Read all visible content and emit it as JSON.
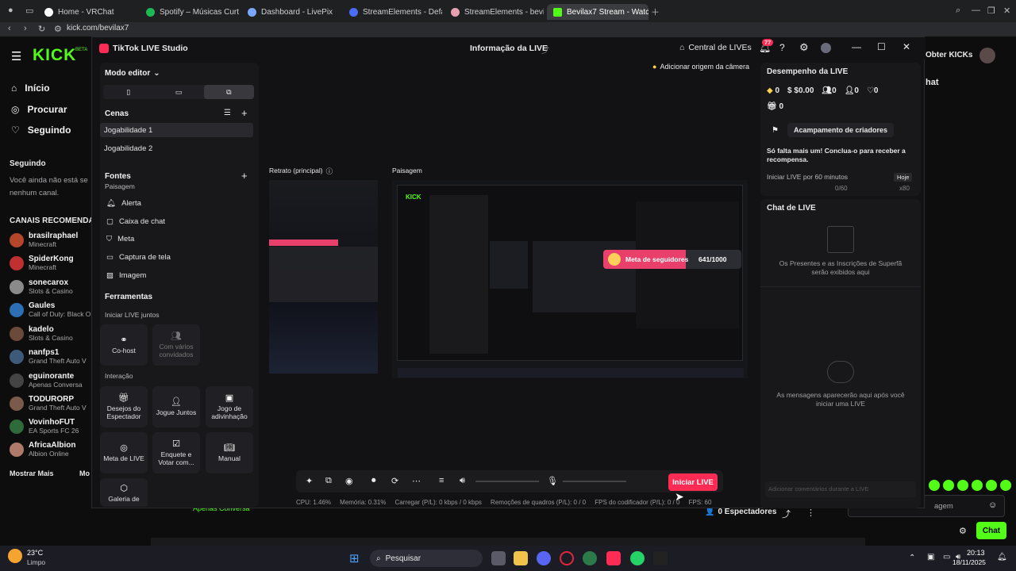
{
  "browser": {
    "tabs": [
      {
        "label": "Home - VRChat",
        "color": "#ffffff"
      },
      {
        "label": "Spotify – Músicas Curtid",
        "color": "#1db954"
      },
      {
        "label": "Dashboard - LivePix",
        "color": "#7aa8ff"
      },
      {
        "label": "StreamElements - Defaul",
        "color": "#4a6cf7"
      },
      {
        "label": "StreamElements - bevila",
        "color": "#e6a0b0"
      },
      {
        "label": "Bevilax7 Stream - Watch",
        "color": "#53fc18"
      }
    ],
    "url": "kick.com/bevilax7"
  },
  "kick": {
    "logo": "KICK",
    "logo_badge": "BETA",
    "nav": [
      "Início",
      "Procurar",
      "Seguindo"
    ],
    "following_title": "Seguindo",
    "following_empty": "Você ainda não está se",
    "following_empty2": "nenhum canal.",
    "recommended_title": "CANAIS RECOMENDA",
    "channels": [
      {
        "name": "brasilraphael",
        "game": "Minecraft"
      },
      {
        "name": "SpiderKong",
        "game": "Minecraft"
      },
      {
        "name": "sonecarox",
        "game": "Slots & Casino"
      },
      {
        "name": "Gaules",
        "game": "Call of Duty: Black O"
      },
      {
        "name": "kadelo",
        "game": "Slots & Casino"
      },
      {
        "name": "nanfps1",
        "game": "Grand Theft Auto V"
      },
      {
        "name": "eguinorante",
        "game": "Apenas Conversa"
      },
      {
        "name": "TODURORP",
        "game": "Grand Theft Auto V"
      },
      {
        "name": "VovinhoFUT",
        "game": "EA Sports FC 26"
      },
      {
        "name": "AfricaAlbion",
        "game": "Albion Online"
      }
    ],
    "show_more": "Mostrar Mais",
    "show_more2": "Mo",
    "get_kicks": "Obter KICKs",
    "chat_label": "hat",
    "viewers": "0 Espectadores",
    "message_placeholder": "agem",
    "chat_button": "Chat",
    "bottom_tag": "Apenas Conversa"
  },
  "studio": {
    "app_title": "TikTok LIVE Studio",
    "live_info": "Informação da LIVE",
    "central": "Central de LIVEs",
    "notif_count": "77",
    "editor_mode": "Modo editor",
    "scenes_title": "Cenas",
    "scenes": [
      "Jogabilidade 1",
      "Jogabilidade 2"
    ],
    "sources_title": "Fontes",
    "sources_cut": "Paisagem",
    "sources": [
      "Alerta",
      "Caixa de chat",
      "Meta",
      "Captura de tela",
      "Imagem"
    ],
    "tools_title": "Ferramentas",
    "together_title": "Iniciar LIVE juntos",
    "cohost": "Co-host",
    "multi": "Com vários convidados",
    "interaction_title": "Interação",
    "interaction": [
      "Desejos do Espectador",
      "Jogue Juntos",
      "Jogo de adivinhação",
      "Meta de LIVE",
      "Enquete e Votar com...",
      "Manual"
    ],
    "gallery": "Galeria de",
    "add_camera": "Adicionar origem da câmera",
    "portrait_label": "Retrato (principal)",
    "landscape_label": "Paisagem",
    "goal_label": "Meta de seguidores",
    "goal_value": "641/1000",
    "go_live": "Iniciar LIVE",
    "status": {
      "cpu": "CPU: 1.46%",
      "mem": "Memória: 0.31%",
      "upload": "Carregar (P/L): 0 kbps / 0 kbps",
      "drops": "Remoções de quadros (P/L): 0 / 0",
      "encoder": "FPS do codificador (P/L): 0 / 0",
      "fps": "FPS: 60"
    },
    "performance_title": "Desempenho da LIVE",
    "perf": [
      "0",
      "$0.00",
      "0",
      "0",
      "0",
      "0"
    ],
    "camp": "Acampamento de criadores",
    "camp_text": "Só falta mais um! Conclua-o para receber a recompensa.",
    "task": "Iniciar LIVE por 60 minutos",
    "task_tag": "Hoje",
    "task_progress": "0/60",
    "task_reward": "x80",
    "chat_title": "Chat de LIVE",
    "gifts_text": "Os Presentes e as Inscrições de Superfã serão exibidos aqui",
    "msgs_text": "As mensagens aparecerão aqui após você iniciar uma LIVE",
    "comment_placeholder": "Adicionar comentários durante a LIVE"
  },
  "taskbar": {
    "weather_temp": "23°C",
    "weather_desc": "Limpo",
    "search": "Pesquisar",
    "time": "20:13",
    "date": "18/11/2025"
  },
  "colors": {
    "kick_green": "#53fc18",
    "tiktok_red": "#fe2c55"
  }
}
